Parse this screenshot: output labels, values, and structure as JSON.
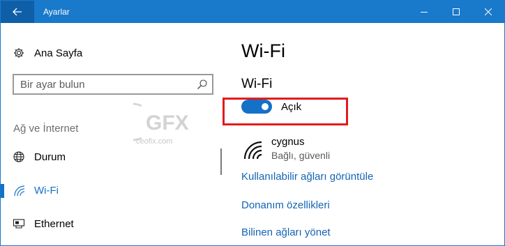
{
  "window": {
    "title": "Ayarlar",
    "accent": "#1979ca",
    "back_icon": "arrow-left-icon",
    "controls": [
      "minimize-icon",
      "maximize-icon",
      "close-icon"
    ]
  },
  "sidebar": {
    "home_label": "Ana Sayfa",
    "search_placeholder": "Bir ayar bulun",
    "section_heading": "Ağ ve İnternet",
    "items": [
      {
        "label": "Durum",
        "icon": "globe-icon",
        "active": false
      },
      {
        "label": "Wi-Fi",
        "icon": "wifi-icon",
        "active": true
      },
      {
        "label": "Ethernet",
        "icon": "ethernet-icon",
        "active": false
      }
    ]
  },
  "watermark": {
    "logo": "GFX",
    "site": "ceofix.com"
  },
  "main": {
    "page_title": "Wi-Fi",
    "section_title": "Wi-Fi",
    "toggle": {
      "label": "Açık",
      "on": true
    },
    "network": {
      "name": "cygnus",
      "status": "Bağlı, güvenli"
    },
    "links": [
      "Kullanılabilir ağları görüntüle",
      "Donanım özellikleri",
      "Bilinen ağları yönet"
    ]
  }
}
